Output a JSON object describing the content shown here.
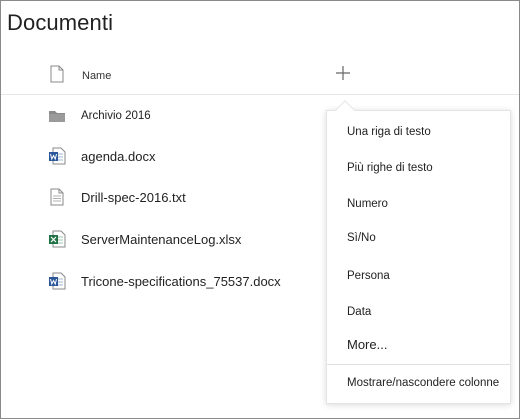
{
  "page": {
    "title": "Documenti"
  },
  "header": {
    "name_label": "Name",
    "add_column_icon": "plus-icon"
  },
  "files": [
    {
      "name": "Archivio 2016",
      "type": "folder",
      "icon": "folder-icon"
    },
    {
      "name": "agenda.docx",
      "type": "word",
      "icon": "word-doc-icon"
    },
    {
      "name": "Drill-spec-2016.txt",
      "type": "text",
      "icon": "text-file-icon"
    },
    {
      "name": "ServerMaintenanceLog.xlsx",
      "type": "excel",
      "icon": "excel-doc-icon"
    },
    {
      "name": "Tricone-specifications_75537.docx",
      "type": "word",
      "icon": "word-doc-icon"
    }
  ],
  "menu": {
    "items": [
      "Una riga di testo",
      "Più righe di testo",
      "Numero",
      "Sì/No",
      "Persona",
      "Data",
      "More..."
    ],
    "footer": "Mostrare/nascondere colonne"
  },
  "colors": {
    "word": "#2b579a",
    "excel": "#217346",
    "folder": "#8a8a8a",
    "border": "#8a8a8a"
  }
}
